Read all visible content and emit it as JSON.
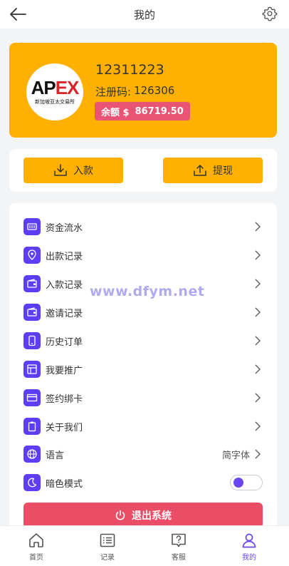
{
  "header": {
    "title": "我的",
    "back_icon": "arrow-left-icon",
    "settings_icon": "gear-icon"
  },
  "profile": {
    "logo_text_main": "AP",
    "logo_text_accent": "EX",
    "logo_subtitle": "新加坡亚太交易所",
    "user_id": "12311223",
    "reg_code_label": "注册码:",
    "reg_code": "126306",
    "balance_label": "余额 $",
    "balance": "86719.50"
  },
  "actions": {
    "deposit": "入款",
    "withdraw": "提现"
  },
  "menu": {
    "items": [
      {
        "label": "资金流水",
        "icon": "ledger-icon"
      },
      {
        "label": "出款记录",
        "icon": "location-pin-icon"
      },
      {
        "label": "入款记录",
        "icon": "wallet-icon"
      },
      {
        "label": "邀请记录",
        "icon": "wallet-icon"
      },
      {
        "label": "历史订单",
        "icon": "phone-icon"
      },
      {
        "label": "我要推广",
        "icon": "layout-icon"
      },
      {
        "label": "签约绑卡",
        "icon": "card-icon"
      },
      {
        "label": "关于我们",
        "icon": "clipboard-icon"
      }
    ],
    "language_label": "语言",
    "language_value": "简字体",
    "dark_mode_label": "暗色模式",
    "logout": "退出系统"
  },
  "watermark": "www.dfym.net",
  "tabbar": {
    "tabs": [
      {
        "label": "首页",
        "icon": "home-icon"
      },
      {
        "label": "记录",
        "icon": "list-icon"
      },
      {
        "label": "客服",
        "icon": "help-chat-icon"
      },
      {
        "label": "我的",
        "icon": "user-icon",
        "active": true
      }
    ]
  },
  "colors": {
    "accent": "#ffb000",
    "purple": "#5d3df5",
    "danger": "#ea4d66",
    "balance_bg": "#ea5474"
  }
}
